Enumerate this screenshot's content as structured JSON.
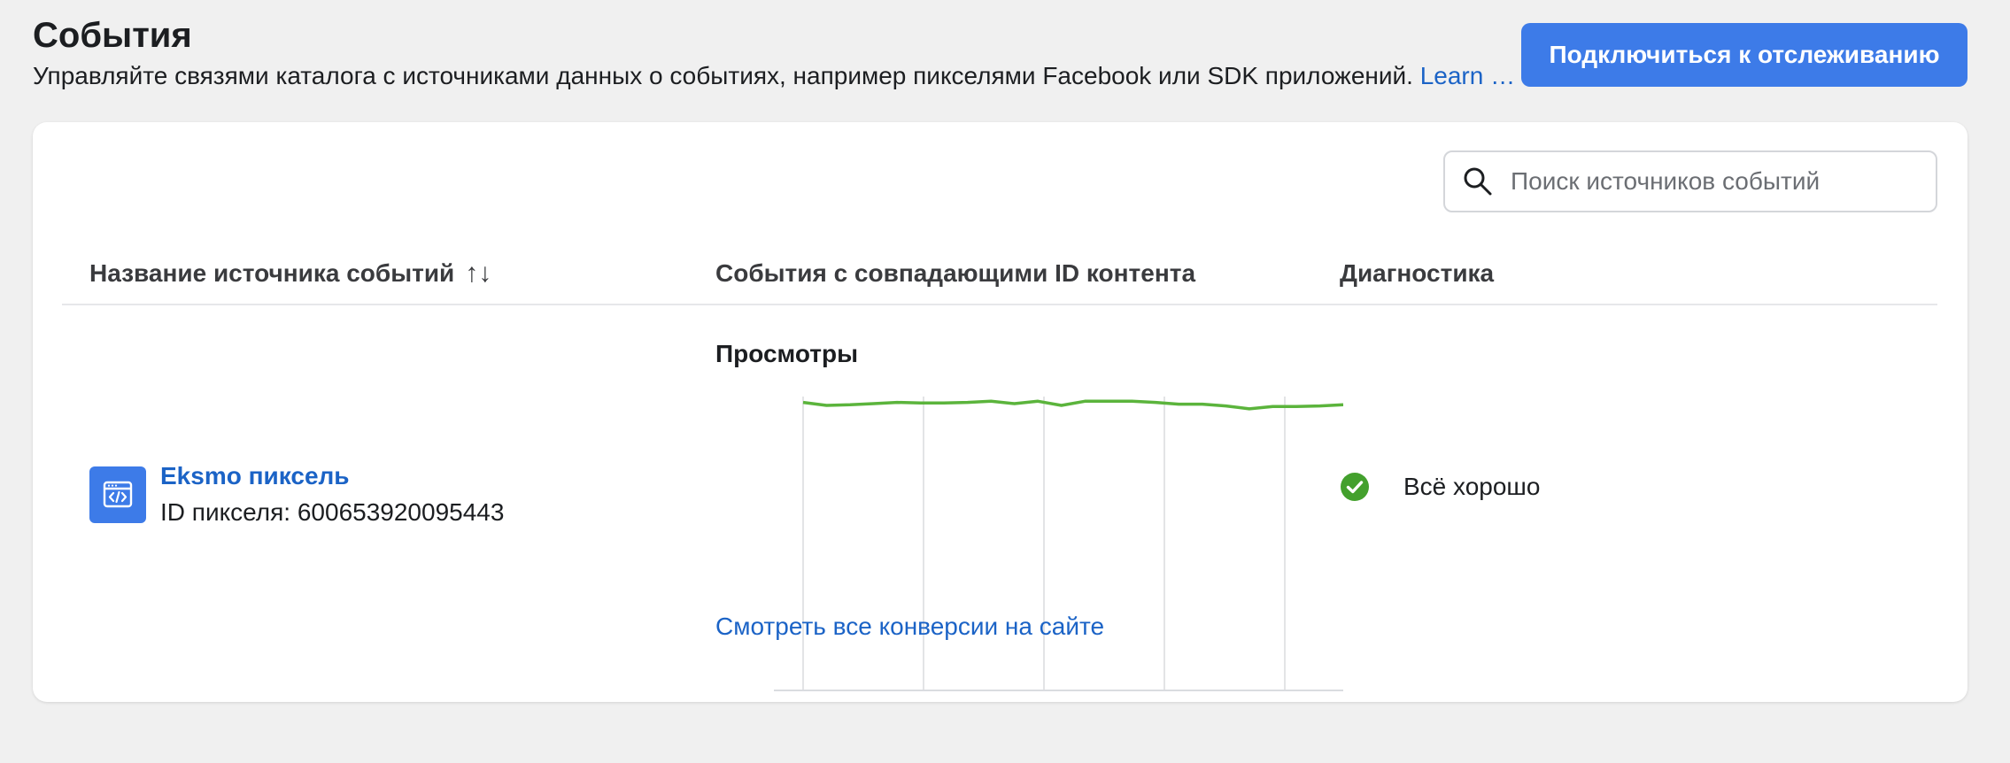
{
  "header": {
    "title": "События",
    "subtitle": "Управляйте связями каталога с источниками данных о событиях, например пикселями Facebook или SDK приложений.",
    "learn_link": "Learn …",
    "connect_button": "Подключиться к отслеживанию"
  },
  "search": {
    "placeholder": "Поиск источников событий",
    "value": ""
  },
  "table": {
    "columns": [
      "Название источника событий",
      "События с совпадающими ID контента",
      "Диагностика"
    ],
    "sort_icon": "↑↓",
    "rows": [
      {
        "source_name": "Eksmo пиксель",
        "source_id": "ID пикселя: 600653920095443",
        "chart_title": "Просмотры",
        "conversions_link": "Смотреть все конверсии на сайте",
        "diagnostics": "Всё хорошо"
      }
    ]
  },
  "chart_data": {
    "type": "line",
    "title": "Просмотры",
    "xlabel": "",
    "ylabel": "",
    "grid": true,
    "y": [
      98,
      97,
      97.2,
      97.6,
      98,
      97.8,
      97.8,
      98,
      98.4,
      97.6,
      98.4,
      97,
      98.4,
      98.4,
      98.4,
      98,
      97.4,
      97.4,
      96.8,
      95.8,
      96.6,
      96.6,
      96.8,
      97.2
    ],
    "ylim": [
      0,
      100
    ],
    "color": "#5bb43c"
  },
  "colors": {
    "accent": "#3d7be8",
    "link": "#1b63c6",
    "success": "#43a02d"
  },
  "icons": {
    "search": "search-icon",
    "pixel": "code-window-icon",
    "status": "check-circle-icon"
  }
}
